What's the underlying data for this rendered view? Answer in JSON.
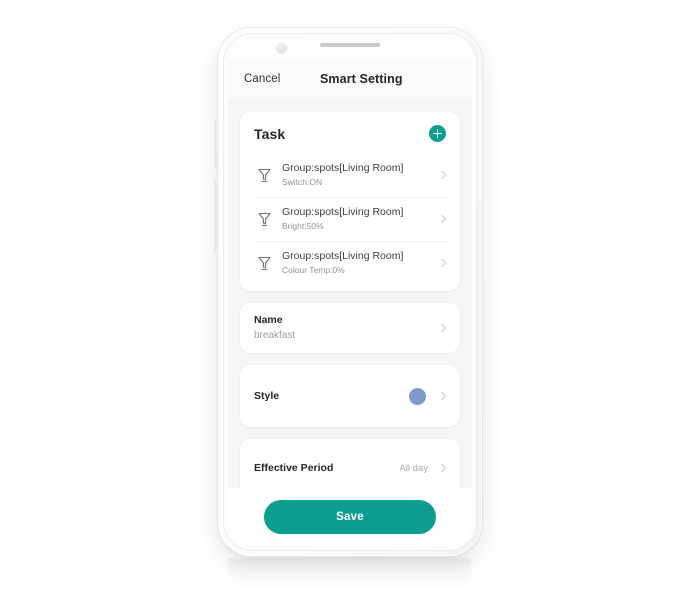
{
  "device": {
    "camera_icon": "camera-dot",
    "speaker_icon": "earpiece-speaker"
  },
  "nav": {
    "cancel_label": "Cancel",
    "title": "Smart Setting"
  },
  "task_card": {
    "title": "Task",
    "add_icon": "plus-icon",
    "rows": [
      {
        "icon": "spotlight-icon",
        "primary": "Group:spots[Living Room]",
        "secondary": "Switch:ON",
        "chevron": "chevron-right-icon"
      },
      {
        "icon": "spotlight-icon",
        "primary": "Group:spots[Living Room]",
        "secondary": "Bright:50%",
        "chevron": "chevron-right-icon"
      },
      {
        "icon": "spotlight-icon",
        "primary": "Group:spots[Living Room]",
        "secondary": "Colour Temp:0%",
        "chevron": "chevron-right-icon"
      }
    ]
  },
  "settings": {
    "name": {
      "label": "Name",
      "value": "breakfast"
    },
    "style": {
      "label": "Style",
      "swatch_color": "#8098c8"
    },
    "effective_period": {
      "label": "Effective Period",
      "value": "All day"
    }
  },
  "footer": {
    "save_label": "Save"
  },
  "colors": {
    "accent_teal": "#0d9e8e",
    "screen_background": "#f5f5f6",
    "card_background": "#ffffff",
    "style_swatch": "#8098c8"
  }
}
